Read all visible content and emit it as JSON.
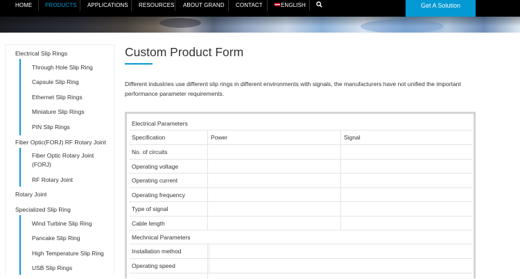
{
  "nav": {
    "items": [
      {
        "label": "HOME",
        "active": false
      },
      {
        "label": "PRODUCTS",
        "active": true
      },
      {
        "label": "APPLICATIONS",
        "active": false
      },
      {
        "label": "RESOURCES",
        "active": false
      },
      {
        "label": "ABOUT GRAND",
        "active": false
      },
      {
        "label": "CONTACT",
        "active": false
      }
    ],
    "language": "ENGLISH",
    "search_icon": "search-icon",
    "cta_label": "Get A Solution",
    "colors": {
      "bar": "#000000",
      "active": "#0399d4",
      "cta": "#0399d4"
    }
  },
  "sidebar": {
    "categories": [
      {
        "label": "Electrical Slip Rings",
        "children": [
          "Through Hole Slip Ring",
          "Capsule Slip Ring",
          "Ethernet Slip Rings",
          "Miniature Slip Rings",
          "PIN Slip Rings"
        ]
      },
      {
        "label": "Fiber Optic(FORJ) RF Rotary Joint",
        "children": [
          "Fiber Optic Rotary Joint (FORJ)",
          "RF Rotary Joint"
        ]
      },
      {
        "label": "Rotary Joint",
        "children": []
      },
      {
        "label": "Specialized Slip Ring",
        "children": [
          "Wind Turbine Slip Ring",
          "Pancake Slip Ring",
          "High Temperature Slip Ring",
          "USB Slip Rings"
        ]
      }
    ]
  },
  "main": {
    "title": "Custom Product Form",
    "intro": "Different industries use different slip rings in different environments with signals, the manufacturers have not unified the important performance parameter requirements.",
    "form": {
      "section_electrical": "Electrical Parameters",
      "header": {
        "col1": "Specification",
        "col2": "Power",
        "col3": "Signal"
      },
      "electrical_rows": [
        "No. of circuits",
        "Operating voltage",
        "Operating current",
        "Operating frequency",
        "Type of signal",
        "Cable length"
      ],
      "section_mechanical": "Mechnical Parameters",
      "mechanical_rows": [
        "Installation method",
        "Operating speed"
      ]
    }
  }
}
